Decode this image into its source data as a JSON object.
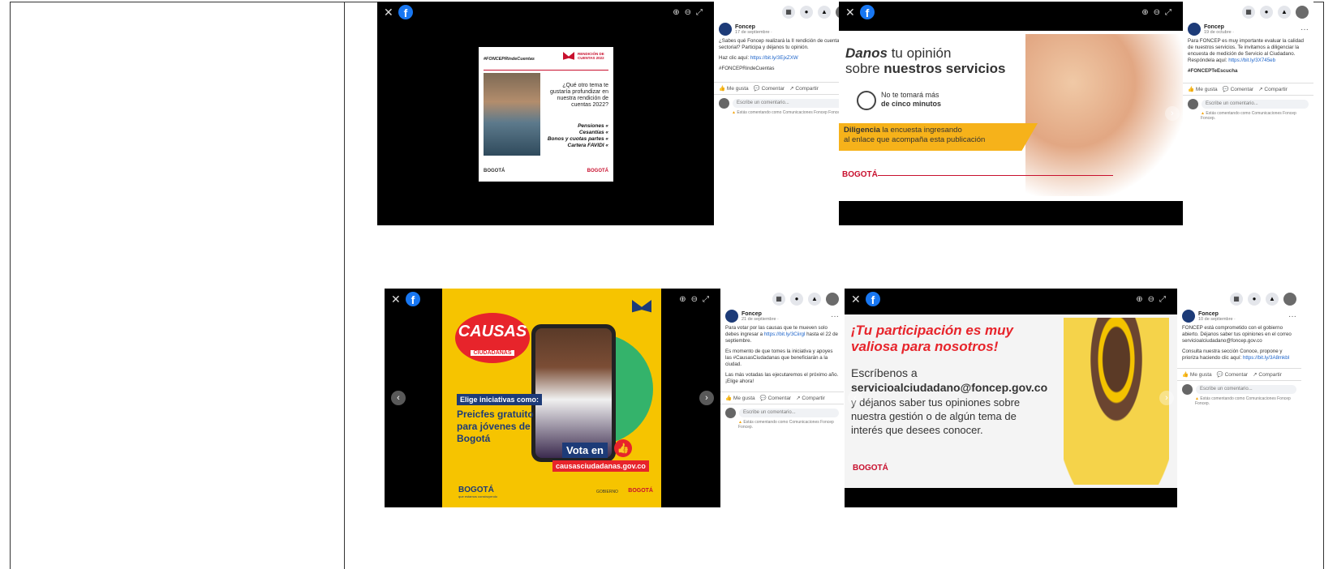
{
  "colors": {
    "facebook_blue": "#1877f2",
    "causas_yellow": "#f6c400",
    "foncep_red": "#c8102e",
    "survey_yellow": "#f6b21a"
  },
  "posts": [
    {
      "page": "Foncep",
      "date": "17 de septiembre ·",
      "text": [
        "¿Sabes qué Foncep realizará la II rendición de cuentas sectorial? Participa y déjanos tu opinión.",
        "Haz clic aquí: ",
        "#FONCEPRindeCuentas"
      ],
      "link": "https://bit.ly/3EjxZXW",
      "actions": {
        "like": "Me gusta",
        "comment": "Comentar",
        "share": "Compartir"
      },
      "comment_placeholder": "Escribe un comentario...",
      "comment_note": "Estás comentando como Comunicaciones Foncep Foncep.",
      "image": {
        "hashtag": "#FONCEPRindeCuentas",
        "badge": "RENDICIÓN DE CUENTAS 2022",
        "question": "¿Qué otro tema te gustaría profundizar en nuestra rendición de cuentas 2022?",
        "topics": [
          "Pensiones «",
          "Cesantías «",
          "Bonos y cuotas partes «",
          "Cartera FAVIDI «"
        ],
        "footer_left": "BOGOTÁ",
        "footer_right": "BOGOTÁ"
      }
    },
    {
      "page": "Foncep",
      "date": "19 de octubre ·",
      "text": [
        "Para FONCEP es muy importante evaluar la calidad de nuestros servicios. Te invitamos a diligenciar la encuesta de medición de Servicio al Ciudadano. Respóndela aquí:",
        "#FONCEPTeEscucha"
      ],
      "link": "https://bit.ly/3X745eb",
      "actions": {
        "like": "Me gusta",
        "comment": "Comentar",
        "share": "Compartir"
      },
      "comment_placeholder": "Escribe un comentario...",
      "comment_note": "Estás comentando como Comunicaciones Foncep Foncep.",
      "image": {
        "title_a": "Danos",
        "title_b": " tu opinión",
        "title_c": "sobre ",
        "title_d": "nuestros servicios",
        "time_1": "No te tomará más",
        "time_2": "de cinco minutos",
        "cta_a": "Diligencia",
        "cta_b": " la encuesta ingresando",
        "cta_c": "al enlace que acompaña esta publicación",
        "logo": "BOGOTÁ"
      }
    },
    {
      "page": "Foncep",
      "date": "21 de septiembre ·",
      "text": [
        "Para votar por las causas que te mueven solo debes ingresar a ",
        "hasta el 22 de septiembre.",
        "Es momento de que tomes la iniciativa y apoyes las #CausasCiudadanas que beneficiarán a la ciudad.",
        "Las más votadas las ejecutaremos el próximo año. ¡Elige ahora!"
      ],
      "link": "https://bit.ly/3Ciirgl",
      "actions": {
        "like": "Me gusta",
        "comment": "Comentar",
        "share": "Compartir"
      },
      "comment_placeholder": "Escribe un comentario...",
      "comment_note": "Estás comentando como Comunicaciones Foncep Foncep.",
      "image": {
        "brand_1": "CAUSAS",
        "brand_2": "CIUDADANAS",
        "elige": "Elige iniciativas como:",
        "initiative": "Preicfes gratuito para jóvenes de Bogotá",
        "vota": "Vota en",
        "url": "causasciudadanas.gov.co",
        "footer_left": "BOGOTÁ",
        "footer_sub": "que estamos construyendo",
        "footer_right": "BOGOTÁ",
        "footer_mid": "GOBIERNO"
      }
    },
    {
      "page": "Foncep",
      "date": "10 de septiembre ·",
      "text": [
        "FONCEP está comprometido con el gobierno abierto. Déjanos saber tus opiniones en el correo servicioalciudadano@foncep.gov.co",
        "Consulta nuestra sección Conoce, propone y prioriza haciendo clic aquí: "
      ],
      "link": "https://bit.ly/3A8mkbI",
      "actions": {
        "like": "Me gusta",
        "comment": "Comentar",
        "share": "Compartir"
      },
      "comment_placeholder": "Escribe un comentario...",
      "comment_note": "Estás comentando como Comunicaciones Foncep Foncep.",
      "image": {
        "headline": "¡Tu participación es muy valiosa para nosotros!",
        "line1": "Escríbenos a",
        "email": "servicioalciudadano@foncep.gov.co",
        "line2": "y déjanos saber tus opiniones sobre nuestra gestión o de algún tema de interés que desees conocer.",
        "logo": "BOGOTÁ"
      }
    }
  ]
}
